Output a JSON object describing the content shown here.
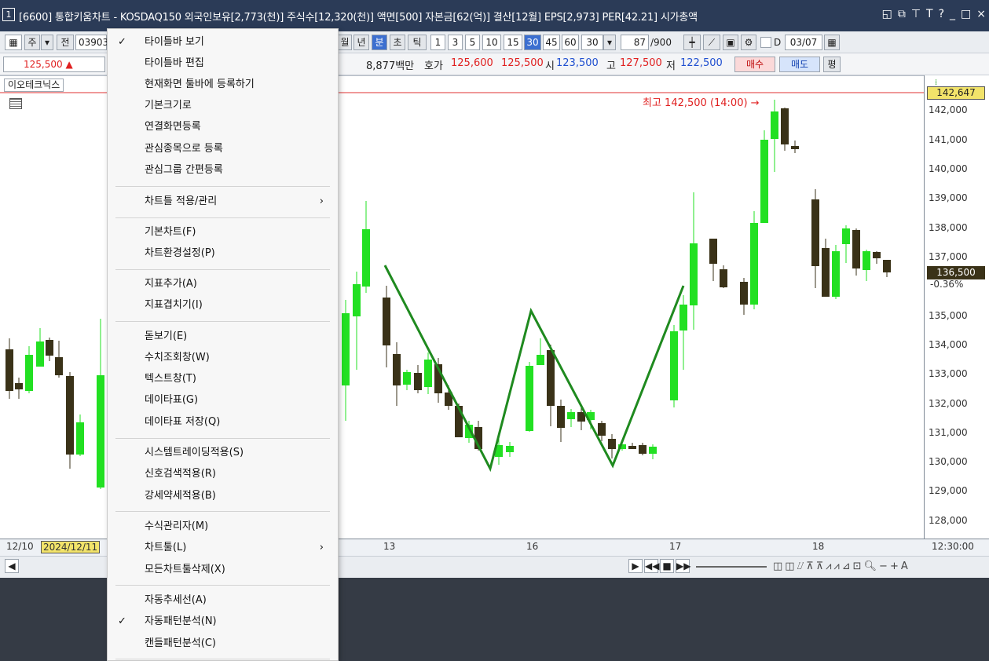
{
  "window": {
    "number": "1",
    "title": "[6600] 통합키움차트 - KOSDAQ150 외국인보유[2,773(천)] 주식수[12,320(천)] 액면[500] 자본금[62(억)] 결산[12월] EPS[2,973] PER[42.21] 시가총액"
  },
  "toolbar": {
    "market": "주",
    "prev_label": "전",
    "code": "03903",
    "period_month": "월",
    "period_year": "년",
    "period_min": "분",
    "period_sec": "초",
    "period_tick": "틱",
    "intervals": [
      "1",
      "3",
      "5",
      "10",
      "15",
      "30",
      "45",
      "60"
    ],
    "interval_select": "30",
    "count": "87",
    "count_total": "/900",
    "date_checkbox_label": "D",
    "date": "03/07"
  },
  "quote": {
    "price": "125,500",
    "trade_value": "8,877백만",
    "ask_bid_label": "호가",
    "ask": "125,600",
    "bid": "125,500",
    "open_label": "시",
    "open": "123,500",
    "high_label": "고",
    "high": "127,500",
    "low_label": "저",
    "low": "122,500",
    "buy_button": "매수",
    "sell_button": "매도",
    "eval_button": "평"
  },
  "chart": {
    "stock_name": "이오테크닉스",
    "high_annotation": "최고 142,500 (14:00) →",
    "last_price_tag": "136,500",
    "change_tag": "-0.36%",
    "top_price_tag": "142,647",
    "y_ticks": [
      "142,000",
      "141,000",
      "140,000",
      "139,000",
      "138,000",
      "137,000",
      "135,000",
      "134,000",
      "133,000",
      "132,000",
      "131,000",
      "130,000",
      "129,000",
      "128,000"
    ],
    "x_ticks": [
      "12/10",
      "2024/12/11",
      "13",
      "16",
      "17",
      "18"
    ],
    "time_label": "12:30:00"
  },
  "context_menu": {
    "items": [
      {
        "label": "타이틀바 보기",
        "checked": true
      },
      {
        "label": "타이틀바 편집"
      },
      {
        "label": "현재화면 툴바에 등록하기"
      },
      {
        "label": "기본크기로"
      },
      {
        "label": "연결화면등록"
      },
      {
        "label": "관심종목으로 등록"
      },
      {
        "label": "관심그룹 간편등록"
      },
      {
        "label": "차트틀 적용/관리",
        "submenu": true
      },
      {
        "label": "기본차트(F)"
      },
      {
        "label": "차트환경설정(P)"
      },
      {
        "label": "지표추가(A)"
      },
      {
        "label": "지표겹치기(I)"
      },
      {
        "label": "돋보기(E)"
      },
      {
        "label": "수치조회창(W)"
      },
      {
        "label": "텍스트창(T)"
      },
      {
        "label": "데이타표(G)"
      },
      {
        "label": "데이타표 저장(Q)"
      },
      {
        "label": "시스템트레이딩적용(S)"
      },
      {
        "label": "신호검색적용(R)"
      },
      {
        "label": "강세약세적용(B)"
      },
      {
        "label": "수식관리자(M)"
      },
      {
        "label": "차트툴(L)",
        "submenu": true
      },
      {
        "label": "모든차트툴삭제(X)"
      },
      {
        "label": "자동추세선(A)"
      },
      {
        "label": "자동패턴분석(N)",
        "checked": true
      },
      {
        "label": "캔들패턴분석(C)"
      }
    ]
  },
  "colors": {
    "titlebar": "#2b3b57",
    "up_candle": "#22e022",
    "down_candle": "#3a3218",
    "pattern_line": "#1f8a1f",
    "high_line": "#e03030"
  }
}
